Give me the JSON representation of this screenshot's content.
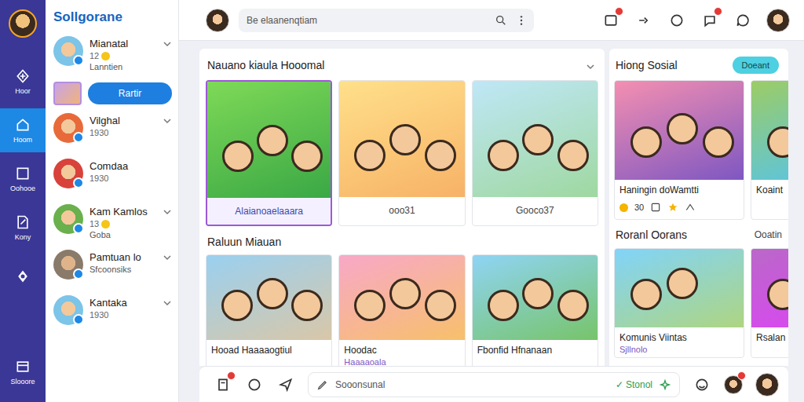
{
  "app": {
    "name": "Sollgorane"
  },
  "nav": {
    "items": [
      {
        "label": "Hoor",
        "selected": false
      },
      {
        "label": "Hoom",
        "selected": true
      },
      {
        "label": "Oohooe",
        "selected": false
      },
      {
        "label": "Kony",
        "selected": false
      }
    ],
    "footer": "Slooore"
  },
  "contacts": [
    {
      "kind": "contact",
      "name": "Mianatal",
      "count": "12",
      "emoji": true,
      "sub": "Lanntien",
      "menu": true
    },
    {
      "kind": "action",
      "button": "Rartir"
    },
    {
      "kind": "contact",
      "name": "Vilghal",
      "count": "1930",
      "emoji": false,
      "sub": "",
      "menu": true
    },
    {
      "kind": "contact",
      "name": "Comdaa",
      "count": "1930",
      "emoji": false,
      "sub": "",
      "menu": false
    },
    {
      "kind": "contact",
      "name": "Kam Kamlos",
      "count": "13",
      "emoji": true,
      "sub": "Goba",
      "menu": true
    },
    {
      "kind": "contact",
      "name": "Pamtuan lo",
      "count": "",
      "emoji": false,
      "sub": "Sfcoonsiks",
      "menu": true
    },
    {
      "kind": "contact",
      "name": "Kantaka",
      "count": "1930",
      "emoji": false,
      "sub": "",
      "menu": true
    }
  ],
  "topbar": {
    "search": {
      "placeholder": "Be elaanenqtiam"
    },
    "icons": [
      {
        "badge": true
      },
      {
        "badge": false
      },
      {
        "badge": false
      },
      {
        "badge": true
      },
      {
        "badge": false
      }
    ]
  },
  "main": {
    "title": "Nauano kiaula Hooomal",
    "cards": [
      {
        "caption": "Alaianoaelaaara",
        "selected": true
      },
      {
        "caption": "ooo31",
        "selected": false
      },
      {
        "caption": "Gooco37",
        "selected": false
      }
    ],
    "section": "Raluun Miauan",
    "cards2": [
      {
        "caption": "Hooad Haaaaogtiul",
        "sub": ""
      },
      {
        "caption": "Hoodac",
        "sub": "Haaaaoala"
      },
      {
        "caption": "Fbonfid Hfnanaan",
        "sub": ""
      }
    ]
  },
  "side": {
    "title": "Hiong Sosial",
    "button": "Doeant",
    "cards": [
      {
        "caption": "Haningin doWamtti",
        "stat": "30"
      },
      {
        "caption": "Koaint",
        "stat": ""
      }
    ],
    "section": "Roranl Oorans",
    "link": "Ooatin",
    "cards2": [
      {
        "caption": "Komunis Viintas",
        "sub": "Sjllnolo"
      },
      {
        "caption": "Rsalan",
        "sub": ""
      }
    ]
  },
  "bottombar": {
    "placeholder": "Sooonsunal",
    "status": "Stonol",
    "badge": true
  }
}
